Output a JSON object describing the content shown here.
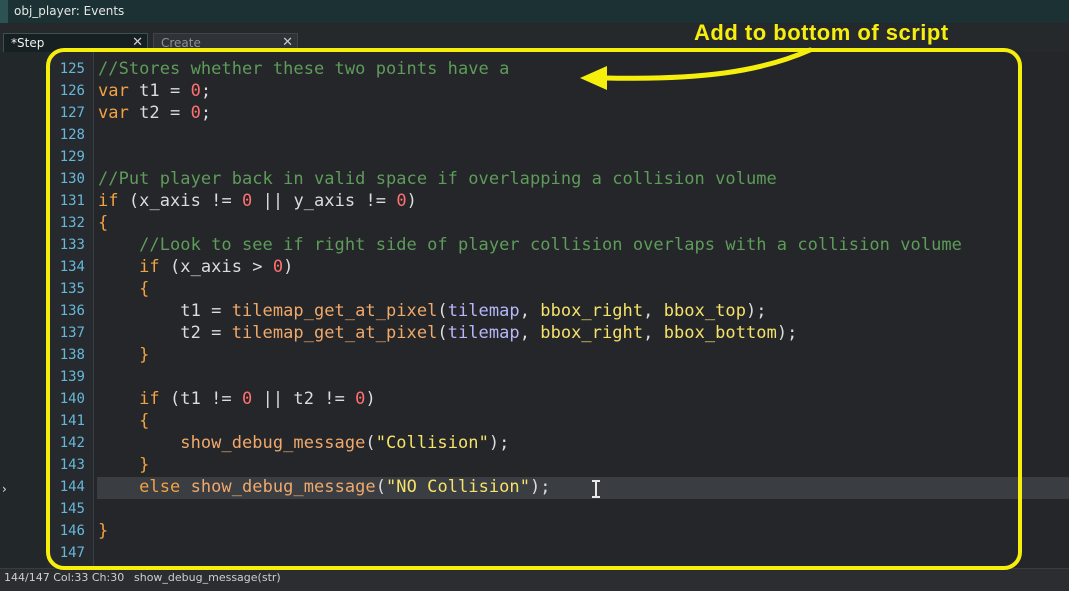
{
  "window": {
    "title": "obj_player: Events"
  },
  "tabs": [
    {
      "label": "*Step",
      "close": "✕",
      "active": true
    },
    {
      "label": "Create",
      "close": "✕",
      "active": false
    }
  ],
  "annotation": {
    "text": "Add to bottom of script",
    "color": "#f6ef0e"
  },
  "status": {
    "position": "144/147 Col:33 Ch:30",
    "signature": "show_debug_message(str)"
  },
  "editor": {
    "lines": [
      {
        "num": "125",
        "tokens": [
          {
            "t": "cm",
            "v": "//Stores whether these two points have a"
          }
        ]
      },
      {
        "num": "126",
        "tokens": [
          {
            "t": "kw",
            "v": "var"
          },
          {
            "t": "op",
            "v": " t1 = "
          },
          {
            "t": "num",
            "v": "0"
          },
          {
            "t": "op",
            "v": ";"
          }
        ]
      },
      {
        "num": "127",
        "tokens": [
          {
            "t": "kw",
            "v": "var"
          },
          {
            "t": "op",
            "v": " t2 = "
          },
          {
            "t": "num",
            "v": "0"
          },
          {
            "t": "op",
            "v": ";"
          }
        ]
      },
      {
        "num": "128",
        "tokens": []
      },
      {
        "num": "129",
        "tokens": []
      },
      {
        "num": "130",
        "tokens": [
          {
            "t": "cm",
            "v": "//Put player back in valid space if overlapping a collision volume"
          }
        ]
      },
      {
        "num": "131",
        "tokens": [
          {
            "t": "kw",
            "v": "if"
          },
          {
            "t": "op",
            "v": " ("
          },
          {
            "t": "op",
            "v": "x_axis"
          },
          {
            "t": "op",
            "v": " != "
          },
          {
            "t": "num",
            "v": "0"
          },
          {
            "t": "op",
            "v": " || "
          },
          {
            "t": "op",
            "v": "y_axis"
          },
          {
            "t": "op",
            "v": " != "
          },
          {
            "t": "num",
            "v": "0"
          },
          {
            "t": "op",
            "v": ")"
          }
        ]
      },
      {
        "num": "132",
        "tokens": [
          {
            "t": "kw",
            "v": "{"
          }
        ]
      },
      {
        "num": "133",
        "tokens": [
          {
            "t": "op",
            "v": "    "
          },
          {
            "t": "cm",
            "v": "//Look to see if right side of player collision overlaps with a collision volume"
          }
        ]
      },
      {
        "num": "134",
        "tokens": [
          {
            "t": "op",
            "v": "    "
          },
          {
            "t": "kw",
            "v": "if"
          },
          {
            "t": "op",
            "v": " (x_axis > "
          },
          {
            "t": "num",
            "v": "0"
          },
          {
            "t": "op",
            "v": ")"
          }
        ]
      },
      {
        "num": "135",
        "tokens": [
          {
            "t": "op",
            "v": "    "
          },
          {
            "t": "kw",
            "v": "{"
          }
        ]
      },
      {
        "num": "136",
        "tokens": [
          {
            "t": "op",
            "v": "        t1 = "
          },
          {
            "t": "fn",
            "v": "tilemap_get_at_pixel"
          },
          {
            "t": "op",
            "v": "("
          },
          {
            "t": "var",
            "v": "tilemap"
          },
          {
            "t": "op",
            "v": ", "
          },
          {
            "t": "str",
            "v": "bbox_right"
          },
          {
            "t": "op",
            "v": ", "
          },
          {
            "t": "str",
            "v": "bbox_top"
          },
          {
            "t": "op",
            "v": ");"
          }
        ]
      },
      {
        "num": "137",
        "tokens": [
          {
            "t": "op",
            "v": "        t2 = "
          },
          {
            "t": "fn",
            "v": "tilemap_get_at_pixel"
          },
          {
            "t": "op",
            "v": "("
          },
          {
            "t": "var",
            "v": "tilemap"
          },
          {
            "t": "op",
            "v": ", "
          },
          {
            "t": "str",
            "v": "bbox_right"
          },
          {
            "t": "op",
            "v": ", "
          },
          {
            "t": "str",
            "v": "bbox_bottom"
          },
          {
            "t": "op",
            "v": ");"
          }
        ]
      },
      {
        "num": "138",
        "tokens": [
          {
            "t": "op",
            "v": "    "
          },
          {
            "t": "kw",
            "v": "}"
          }
        ]
      },
      {
        "num": "139",
        "tokens": []
      },
      {
        "num": "140",
        "tokens": [
          {
            "t": "op",
            "v": "    "
          },
          {
            "t": "kw",
            "v": "if"
          },
          {
            "t": "op",
            "v": " (t1 != "
          },
          {
            "t": "num",
            "v": "0"
          },
          {
            "t": "op",
            "v": " || t2 != "
          },
          {
            "t": "num",
            "v": "0"
          },
          {
            "t": "op",
            "v": ")"
          }
        ]
      },
      {
        "num": "141",
        "tokens": [
          {
            "t": "op",
            "v": "    "
          },
          {
            "t": "kw",
            "v": "{"
          }
        ]
      },
      {
        "num": "142",
        "tokens": [
          {
            "t": "op",
            "v": "        "
          },
          {
            "t": "fn",
            "v": "show_debug_message"
          },
          {
            "t": "op",
            "v": "("
          },
          {
            "t": "str",
            "v": "\"Collision\""
          },
          {
            "t": "op",
            "v": ");"
          }
        ]
      },
      {
        "num": "143",
        "tokens": [
          {
            "t": "op",
            "v": "    "
          },
          {
            "t": "kw",
            "v": "}"
          }
        ]
      },
      {
        "num": "144",
        "tokens": [
          {
            "t": "op",
            "v": "    "
          },
          {
            "t": "kw",
            "v": "else"
          },
          {
            "t": "op",
            "v": " "
          },
          {
            "t": "fn",
            "v": "show_debug_message"
          },
          {
            "t": "op",
            "v": "("
          },
          {
            "t": "str",
            "v": "\"NO Collision\""
          },
          {
            "t": "op",
            "v": ");"
          }
        ]
      },
      {
        "num": "145",
        "tokens": []
      },
      {
        "num": "146",
        "tokens": [
          {
            "t": "kw",
            "v": "}"
          }
        ]
      },
      {
        "num": "147",
        "tokens": []
      }
    ]
  }
}
